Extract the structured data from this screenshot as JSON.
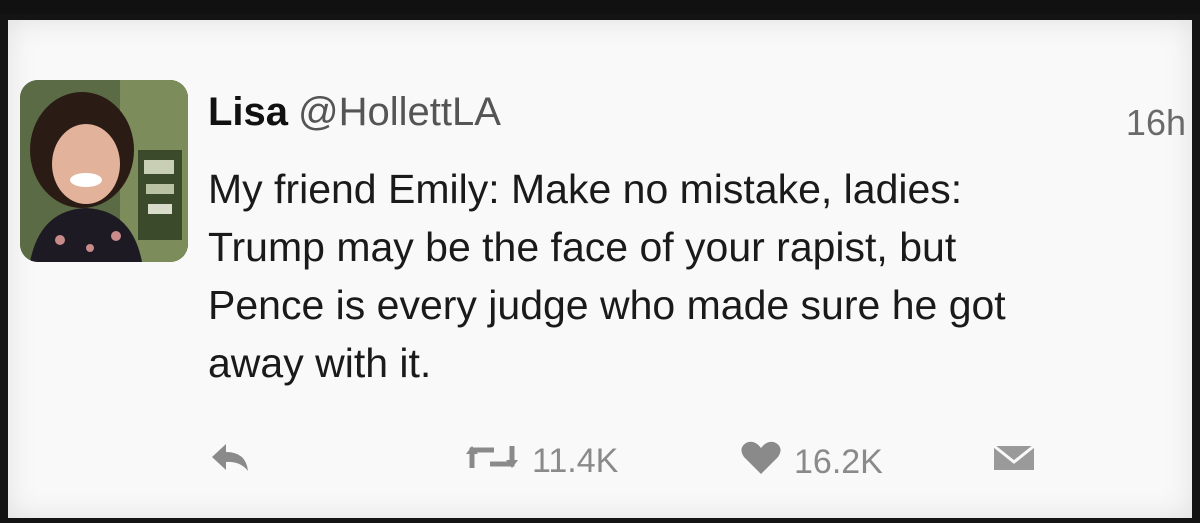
{
  "tweet": {
    "author_name": "Lisa",
    "author_handle": "@HollettLA",
    "timestamp": "16h",
    "text_lines": [
      "My friend Emily: Make no mistake, ladies:",
      "Trump may be the face of your rapist, but",
      "Pence is every judge who made sure he got",
      "away with it."
    ]
  },
  "actions": {
    "reply_icon": "reply-arrow-icon",
    "retweet_icon": "retweet-icon",
    "retweet_count": "11.4K",
    "like_icon": "heart-icon",
    "like_count": "16.2K",
    "dm_icon": "envelope-icon"
  },
  "colors": {
    "card_background": "#f9f9f9",
    "name_text": "#111111",
    "body_text": "#1a1a1a",
    "muted_text": "#8a8a8a",
    "frame": "#141414"
  }
}
